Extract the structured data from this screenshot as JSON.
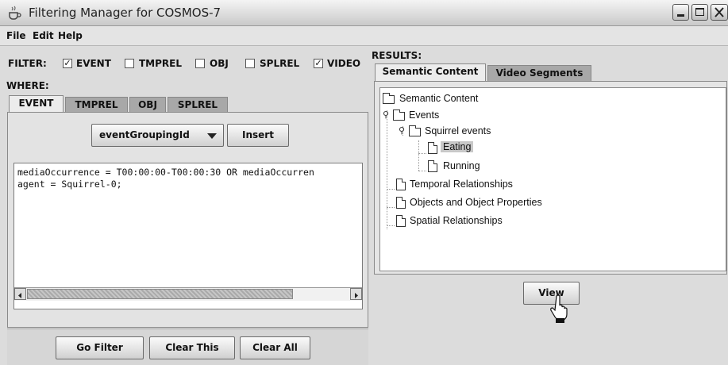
{
  "window": {
    "title": "Filtering Manager for COSMOS-7"
  },
  "menu": {
    "items": [
      "File",
      "Edit",
      "Help"
    ]
  },
  "filter": {
    "label": "FILTER:",
    "options": [
      {
        "label": "EVENT",
        "checked": true
      },
      {
        "label": "TMPREL",
        "checked": false
      },
      {
        "label": "OBJ",
        "checked": false
      },
      {
        "label": "SPLREL",
        "checked": false
      },
      {
        "label": "VIDEO",
        "checked": true
      }
    ]
  },
  "where": {
    "label": "WHERE:",
    "tabs": [
      "EVENT",
      "TMPREL",
      "OBJ",
      "SPLREL"
    ],
    "active_tab": "EVENT",
    "dropdown_value": "eventGroupingId",
    "insert_label": "Insert",
    "query_lines": [
      "mediaOccurrence = T00:00:00-T00:00:30 OR mediaOccurren",
      "agent = Squirrel-0;"
    ]
  },
  "actions": {
    "go_filter": "Go Filter",
    "clear_this": "Clear This",
    "clear_all": "Clear All"
  },
  "results": {
    "label": "RESULTS:",
    "tabs": [
      "Semantic Content",
      "Video Segments"
    ],
    "active_tab": "Semantic Content",
    "tree": {
      "root": "Semantic Content",
      "events": "Events",
      "squirrel_events": "Squirrel events",
      "eating": "Eating",
      "running": "Running",
      "temporal": "Temporal Relationships",
      "objects": "Objects and Object Properties",
      "spatial": "Spatial Relationships"
    },
    "selected_node": "Eating",
    "view_label": "View"
  },
  "colors": {
    "selection": "#c8c8c8",
    "tab_inactive": "#a8a8a8"
  }
}
